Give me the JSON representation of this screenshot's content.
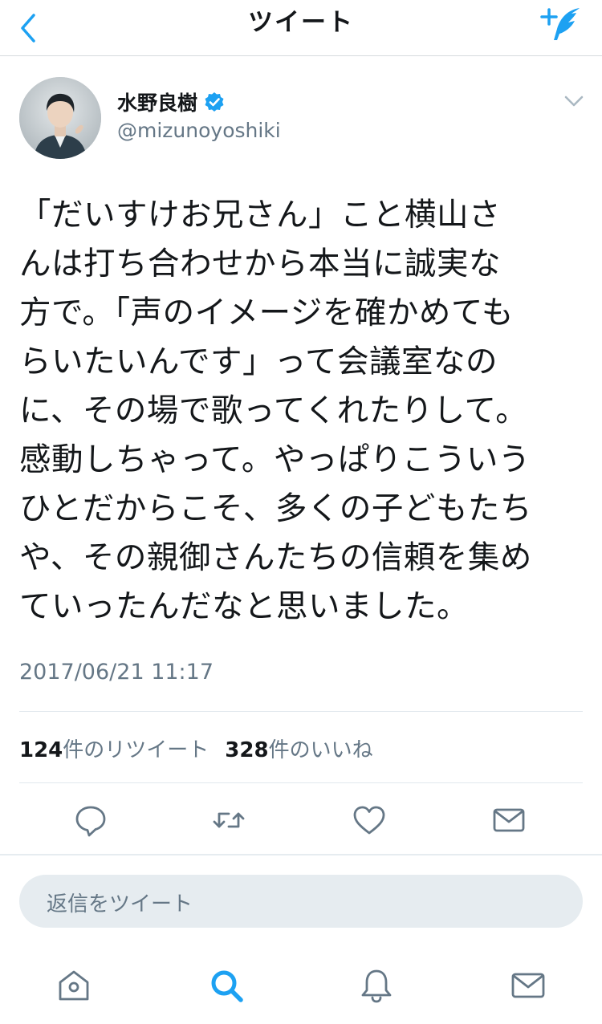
{
  "nav": {
    "title": "ツイート",
    "back_icon": "chevron-left-icon",
    "compose_icon": "compose-tweet-icon"
  },
  "tweet": {
    "display_name": "水野良樹",
    "handle": "@mizunoyoshiki",
    "verified": true,
    "text": "「だいすけお兄さん」こと横山さ\nんは打ち合わせから本当に誠実な\n方で。「声のイメージを確かめても\nらいたいんです」って会議室なの\nに、その場で歌ってくれたりして。\n感動しちゃって。やっぱりこういう\nひとだからこそ、多くの子どもたち\nや、その親御さんたちの信頼を集め\nていったんだなと思いました。",
    "timestamp": "2017/06/21 11:17",
    "retweet_count": "124",
    "retweet_label": "件のリツイート",
    "like_count": "328",
    "like_label": "件のいいね"
  },
  "actions": [
    "reply-icon",
    "retweet-icon",
    "like-icon",
    "direct-message-icon"
  ],
  "reply": {
    "placeholder": "返信をツイート"
  },
  "tabbar": [
    "home-icon",
    "search-icon",
    "notifications-icon",
    "messages-icon"
  ],
  "colors": {
    "accent": "#1da1f2",
    "text": "#14171a",
    "secondary": "#657786",
    "divider": "#e1e8ed",
    "icon": "#657786"
  }
}
